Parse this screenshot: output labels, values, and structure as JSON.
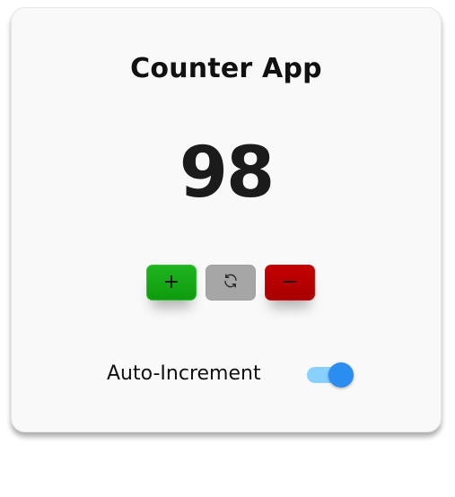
{
  "app": {
    "title": "Counter App",
    "count": "98"
  },
  "controls": {
    "increment_label": "+",
    "reset_icon": "refresh-icon",
    "decrement_label": "−"
  },
  "auto_increment": {
    "label": "Auto-Increment",
    "enabled": true
  },
  "colors": {
    "increment": "#13a813",
    "reset": "#a6a6a6",
    "decrement": "#b80000",
    "toggle_track": "#89d0ff",
    "toggle_knob": "#2c8df0"
  }
}
